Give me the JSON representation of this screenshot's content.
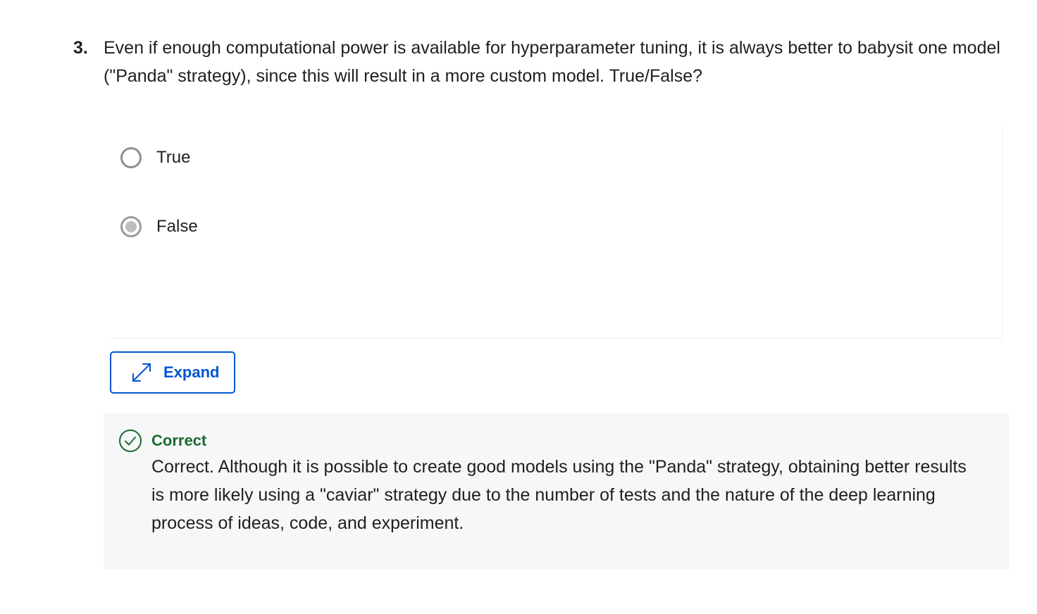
{
  "question": {
    "number": "3.",
    "text": "Even if enough computational power is available for hyperparameter tuning, it is always better to babysit one model (\"Panda\" strategy), since this will result in a more custom model. True/False?"
  },
  "options": [
    {
      "label": "True",
      "selected": false
    },
    {
      "label": "False",
      "selected": true
    }
  ],
  "expand_button": {
    "label": "Expand",
    "icon": "expand-arrows-icon"
  },
  "feedback": {
    "status": "Correct",
    "icon": "check-circle-icon",
    "text": "Correct. Although it is possible to create good models using the \"Panda\" strategy, obtaining better results is more likely using a \"caviar\" strategy due to the number of tests and the nature of the deep learning process of ideas, code, and experiment."
  },
  "colors": {
    "accent": "#0056d2",
    "correct": "#1e6b32",
    "feedback_bg": "#f5f7f8"
  }
}
